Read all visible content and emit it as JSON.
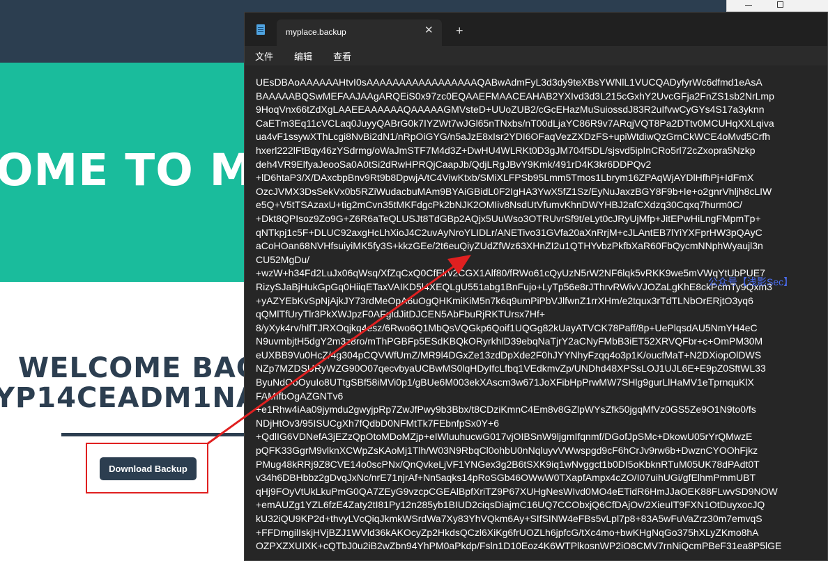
{
  "site": {
    "hero_title": "OME TO M",
    "welcome_line1": "WELCOME BAC",
    "welcome_line2": "YP14CEADM1NAC",
    "download_label": "Download Backup"
  },
  "watermark": "公众号【浅影Sec】",
  "notepad": {
    "tab_title": "myplace.backup",
    "close_glyph": "✕",
    "new_tab_glyph": "+",
    "menu": {
      "file": "文件",
      "edit": "编辑",
      "view": "查看"
    },
    "content": [
      "UEsDBAoAAAAAAHtvI0sAAAAAAAAAAAAAAAAAQABwAdmFyL3d3dy9teXBsYWNlL1VUCQADyfyrWc6dfmd1eAsA",
      "BAAAAABQSwMEFAAJAAgARQEiS0x97zc0EQAAEFMAACEAHAB2YXIvd3d3L215cGxhY2UvcGFja2FnZS1sb2NrLmp",
      "9HoqVnx66tZdXgLAAEEAAAAAAQAAAAAGMVsteD+UUoZUB2/cGcEHazMuSuiossdJ83R2uIfvwCyGYs4S17a3yknn",
      "CaETm3Eq11cVCLaq0JuyyQABrG0k7IYZWt7wJGl65nTNxbs/nT00dLjaYC86R9v7ARqjVQT8Pa2DTtv0MCUHqXXLqiva",
      "ua4vF1ssywXThLcgi8NvBi2dN1/nRpOiGYG/n5aJzE8xIsr2YDI6OFaqVezZXDzFS+upiWtdiwQzGrnCkWCE4oMvd5Crfh",
      "hxerl222lFtBqy46zYSdrmg/oWaJmSTF7M4d3Z+DwHU4WLRKt0D3gJM704f5DL/sjsvd5ipInCRo5rl72cZxopra5Nzkp",
      "deh4VR9ElfyaJeooSa0A0tSi2dRwHPRQjCaapJb/QdjLRgJBvY9Kmk/491rD4K3kr6DDPQv2",
      "+lD6htaP3/X/DAxcbpBnv9Rt9b8DpwjA/tC4ViwKtxb/SMiXLFPSb95Lmm5Tmos1Lbrym16ZPAqWjAYDlHfhPj+IdFmX",
      "OzcJVMX3DsSekVx0b5RZiWudacbuMAm9BYAiGBidL0F2IgHA3YwX5fZ1Sz/EyNuJaxzBGY8F9b+Ie+o2gnrVhljh8cLIW",
      "e5Q+V5tTSAzaxU+tig2mCvn35tMKFdgcPk2bNJK2OMIiv8NsdUtVfumvKhnDWYHBJ2afCXdzq30Cqxq7hurm0C/",
      "+Dkt8QPIsoz9Zo9G+Z6R6aTeQLUSJt8TdGBp2AQjx5UuWso3OTRUvrSf9t/eLyt0cJRyUjMfp+JitEPwHiLngFMpmTp+",
      "qNTkpj1c5F+DLUC92axgHcLhXioJ4C2uvAyNroYLIDLr/ANETivo31GVfa20aXnRrjM+cJLAntEB7lYiYXFprHW3pQAyC",
      "aCoHOan68NVHfsuiyiMK5fy3S+kkzGEe/2t6euQiyZUdZfWz63XHnZI2u1QTHYvbzPkfbXaR60FbQycmNNphWyaujl3n",
      "CU52MgDu/",
      "+wzW+h34Fd2LuJx06qWsq/XfZqCxQ0CfElrv2CGX1Alf80/fRWo61cQyUzN5rW2NF6lqk5vRKK9we5mVWqYtUbPUE7",
      "RizySJaBjHukGpGq0HiiqETaxVAIKD5l4XEQLgU551abg1BnFujo+LyTp56e8rJThrvRWivVJOZaLgKhE8ckPcmTy9Qxm3",
      "+yAZYEbKvSpNjAjkJY73rdMeOpA6uOgQHKmiKiM5n7k6q9umPiPbVJlfwnZ1rrXHm/e2tqux3rTdTLNbOrERjtO3yq6",
      "qQMlTfUryTlr3PkXWJpzF0AFgldJitDJCEN5AbFbuRjRKTUrsx7Hf+",
      "8/yXyk4rv/hlfTJRXOqjkq4esz/6Rwo6Q1MbQsVQGkp6Qoif1UQGg82kUayATVCK78Paff/8p+UePlqsdAU5NmYH4eC",
      "N9uvmbjtH5dgY2m3z8ro/mThPGBFp5ESdKBQkORyrkhlD39ebqNaTjrY2aCNyFMbB3iET52XRVQFbr+c+OmPM30M",
      "eUXBB9Vu0HcZ/4g304pCQVWfUmZ/MR9l4DGxZe13zdDpXde2F0hJYYNhyFzqq4o3p1K/oucfMaT+N2DXiopOlDWS",
      "NZp7MZDSURyWZG90O07qecvbyaUCBwMS0lqHDyIfcLfbq1VEdkmvZp/UNDhd48XPSsLOJ1UJL6E+E9pZ0SftWL33",
      "ByuNdOoOyuIo8UTtgSBf58iMVi0p1/gBUe6M003ekXAscm3w671JoXFibHpPrwMW7SHlg9gurLlHaMV1eTprnquKlX",
      "FAMIfbOgAZGNTv6",
      "+e1Rhw4iAa09jymdu2gwyjpRp7ZwJfPwy9b3Bbx/t8CDziKmnC4Em8v8GZlpWYsZfk50jgqMfVz0GS5Ze9O1N9to0/fs",
      "NDjHtOv3/95ISUCgXh7fQdbD0NFMtTk7FEbnfpSx0Y+6",
      "+QdlIG6VDNefA3jEZzQpOtoMDoMZjp+eIWluuhucwG017vjOIBSnW9ljgmIfqnmf/DGofJpSMc+DkowU05rYrQMwzE",
      "pQFK33GgrM9vlknXCWpZsKAoMj1Tlh/W03N9RbqCl0ohbU0nNqluyvVWwspgd9cF6hCrJv9rw6b+DwznCYOOhFjkz",
      "PMug48kRRj9Z8CVE14o0scPNx/QnQvkeLjVF1YNGex3g2B6tSXK9iq1wNvggct1b0DI5oKbknRTuM05UK78dPAdt0T",
      "v34h6DBHbbz2gDvqJxNc/nrE71njrAf+Nn5aqks14pRoSGb46OWwW0TXapfAmpx4cZO/I07uihUGi/gfElhmPmmUBT",
      "qHj9FOyVtUkLkuPmG0QA7ZEyG9vzcpCGEAlBpfXriTZ9P67XUHgNesWIvd0MO4eETidR6HmJJaOEK88FLwvSD9NOW",
      "+emAUZg1YZL6fzE4Zaty2tI81Py12n285yb1BIUD2ciqsDiajmC16UQ7CCObxjQ6CfDAjOv/2XieuIT9FXN1OtDuyxocJQ",
      "kU32iQU9KP2d+thvyLVcQiqJkmkWSrdWa7Xy83YhVQkm6Ay+SIfSINW4eFBs5vLpl7p8+83A5wFuVaZrz30m7emvqS",
      "+FFDmgilIskjHVjBZJ1WVld36kAKOcyZp2HkdsQCzl6XiKg6frUOZLh6jpfcG/tXc4mo+bwKHgNqGo375hXLyZKmo8hA",
      "OZPXZXUIXK+cQTbJ0u2iB2wZbn94YhPM0aPkdp/Fsln1D10Eoz4K6WTPlkosnWP2iO8CMV7rnNiQcmPBeF31ea8P5lGE"
    ]
  }
}
